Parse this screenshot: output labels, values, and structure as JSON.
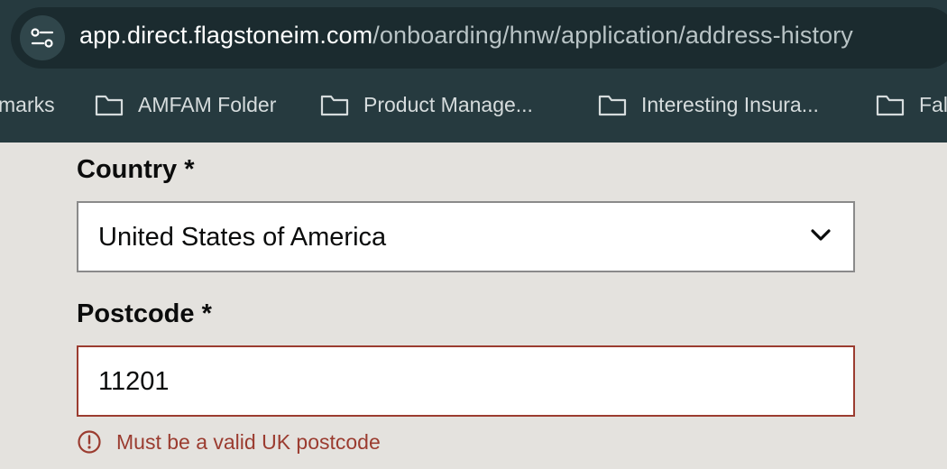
{
  "browser": {
    "url_host": "app.direct.flagstoneim.com",
    "url_path": "/onboarding/hnw/application/address-history",
    "site_info_icon": "tune-icon",
    "bookmarks": [
      {
        "label": "marks"
      },
      {
        "label": "AMFAM Folder",
        "icon": "folder-icon"
      },
      {
        "label": "Product Manage...",
        "icon": "folder-icon"
      },
      {
        "label": "Interesting Insura...",
        "icon": "folder-icon"
      },
      {
        "label": "Fal",
        "icon": "folder-icon"
      }
    ]
  },
  "form": {
    "country": {
      "label": "Country *",
      "value": "United States of America",
      "icon": "chevron-down-icon"
    },
    "postcode": {
      "label": "Postcode *",
      "value": "11201",
      "error": "Must be a valid UK postcode",
      "error_icon": "alert-circle-icon"
    }
  },
  "colors": {
    "chrome_bg": "#263a3f",
    "page_bg": "#e4e2de",
    "error": "#9b3c30",
    "text": "#0b0c0c"
  }
}
